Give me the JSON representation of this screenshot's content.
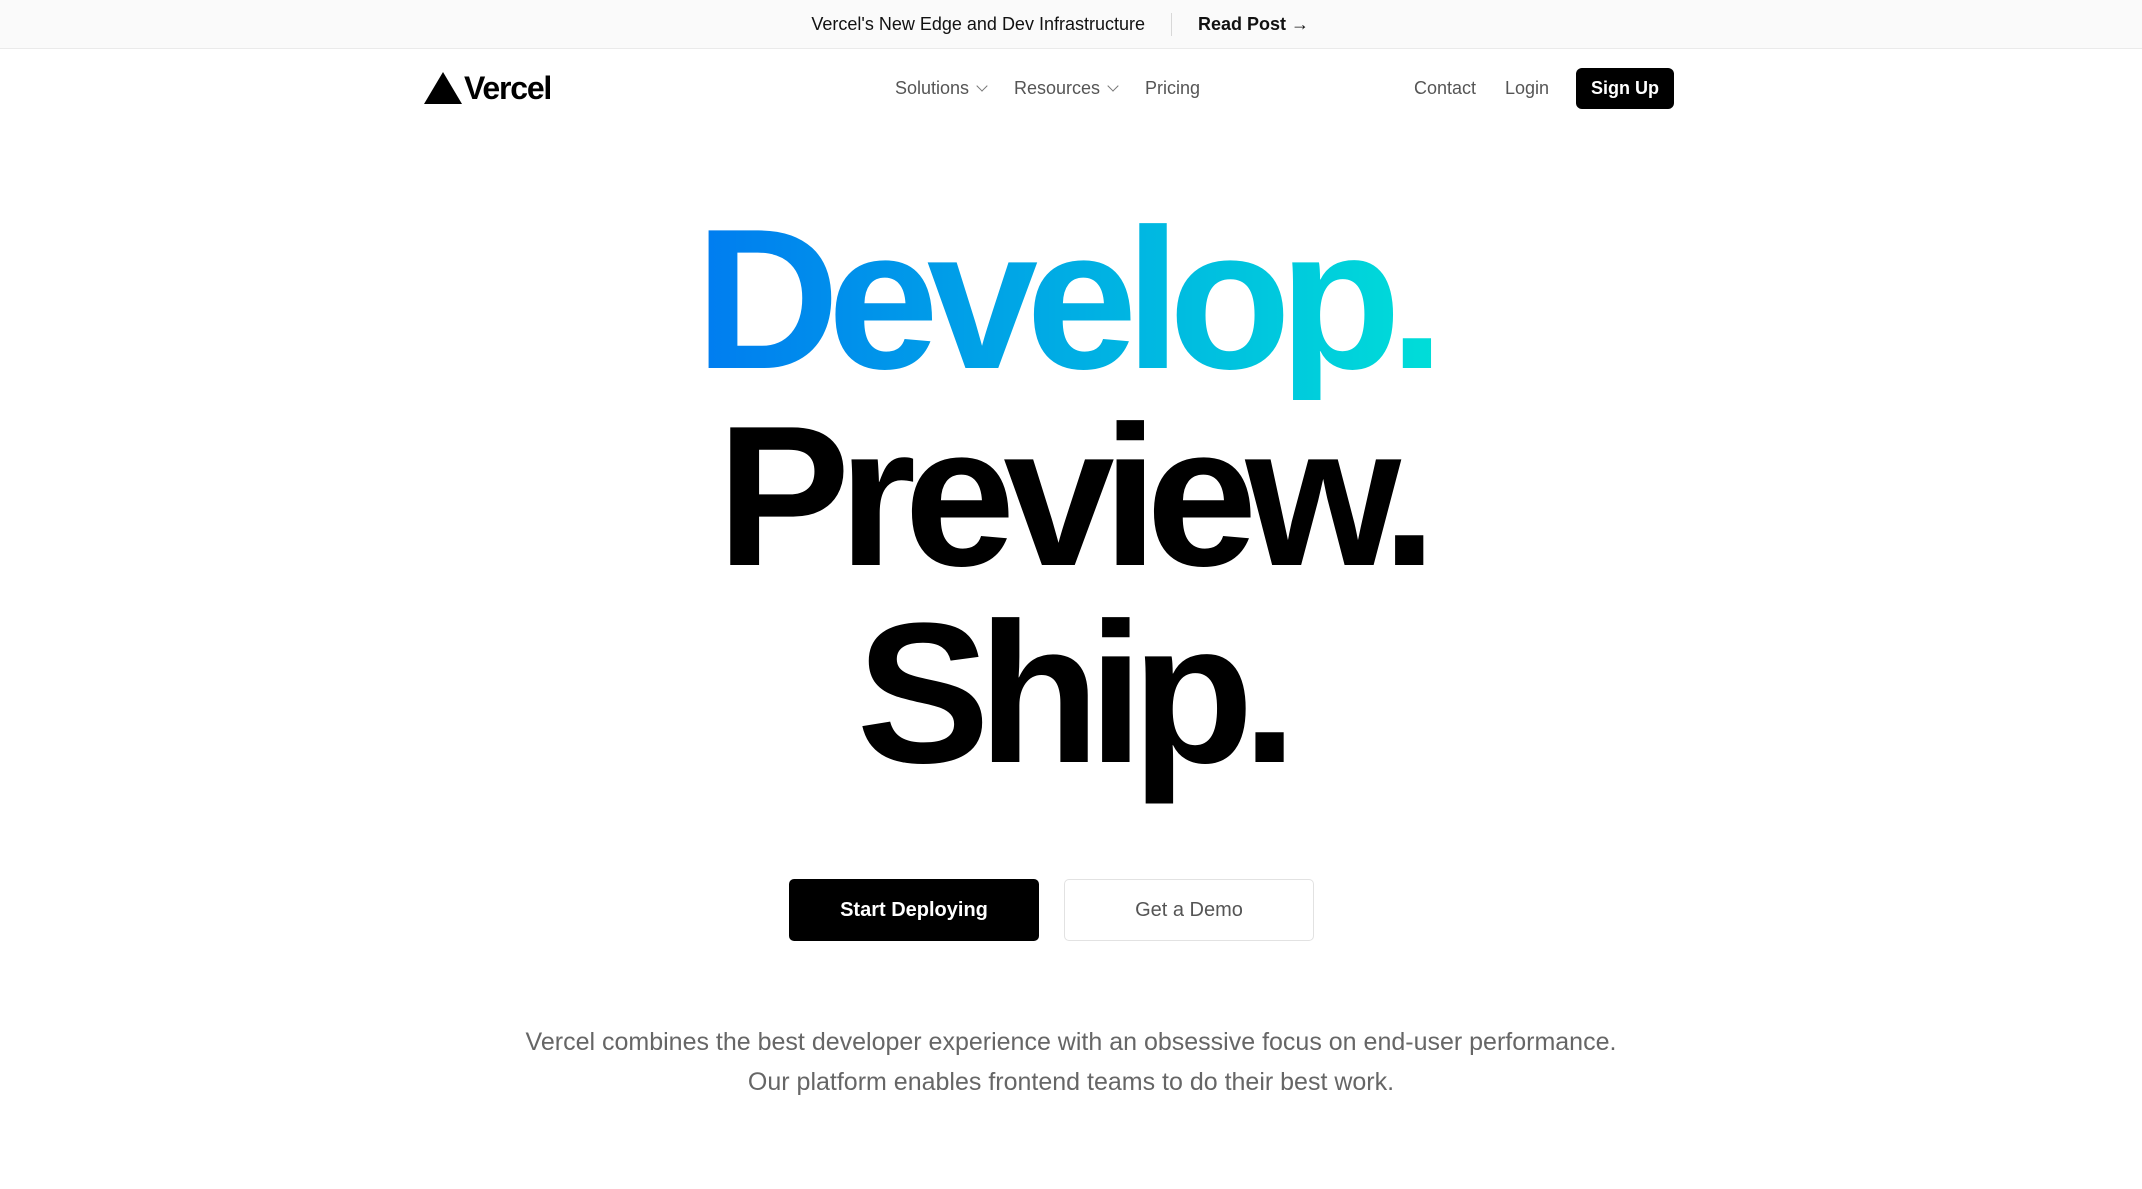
{
  "announcement": {
    "text": "Vercel's New Edge and Dev Infrastructure",
    "link_label": "Read Post →"
  },
  "header": {
    "brand": "Vercel",
    "nav": {
      "solutions": "Solutions",
      "resources": "Resources",
      "pricing": "Pricing"
    },
    "contact": "Contact",
    "login": "Login",
    "signup": "Sign Up"
  },
  "hero": {
    "line1": "Develop.",
    "line2": "Preview.",
    "line3": "Ship.",
    "gradient_colors": [
      "#007cf0",
      "#00dfd8"
    ]
  },
  "cta": {
    "primary": "Start Deploying",
    "secondary": "Get a Demo"
  },
  "description": {
    "line1": "Vercel combines the best developer experience with an obsessive focus on end-user performance.",
    "line2": "Our platform enables frontend teams to do their best work."
  }
}
